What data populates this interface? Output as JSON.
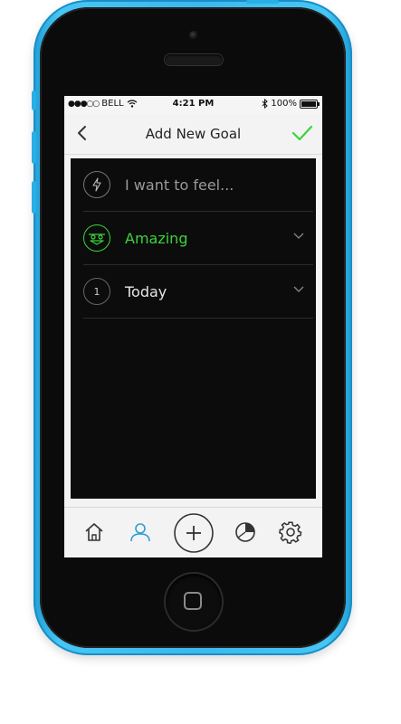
{
  "status_bar": {
    "signal": "●●●○○",
    "carrier": "BELL",
    "time": "4:21 PM",
    "battery": "100%"
  },
  "nav": {
    "title": "Add New Goal",
    "back_icon": "chevron-left-icon",
    "done_icon": "checkmark-icon"
  },
  "form": {
    "rows": [
      {
        "icon": "lightning-icon",
        "text": "I want to feel...",
        "color": "#9a9a9a"
      },
      {
        "icon": "face-icon",
        "text": "Amazing",
        "color": "#3ad43a"
      },
      {
        "icon": "number-badge",
        "badge": "1",
        "text": "Today",
        "color": "#e6e6e6"
      }
    ]
  },
  "tab_bar": {
    "items": [
      "home-icon",
      "profile-icon",
      "add-icon",
      "pie-chart-icon",
      "settings-icon"
    ],
    "active": "profile-icon"
  },
  "colors": {
    "accent_green": "#3ad43a",
    "active_blue": "#2a9fd8",
    "phone_blue": "#3bb8ee"
  }
}
